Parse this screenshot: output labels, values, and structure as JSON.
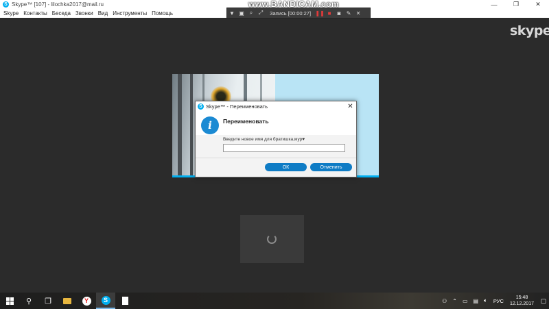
{
  "window": {
    "title": "Skype™ [107] - lilochka2017@mail.ru",
    "minimize_glyph": "—",
    "maximize_glyph": "❐",
    "close_glyph": "✕"
  },
  "menu": {
    "items": [
      {
        "label": "Skype"
      },
      {
        "label": "Контакты"
      },
      {
        "label": "Беседа"
      },
      {
        "label": "Звонки"
      },
      {
        "label": "Вид"
      },
      {
        "label": "Инструменты"
      },
      {
        "label": "Помощь"
      }
    ]
  },
  "bandicam": {
    "brand": "www.BANDICAM.com",
    "record_label": "Запись [00:00:27]"
  },
  "skype_logo": "skype",
  "dialog": {
    "title": "Skype™ - Переименовать",
    "heading": "Переименовать",
    "prompt": "Введите новое имя для братишка,мур♥",
    "input_value": "",
    "ok_label": "ОК",
    "cancel_label": "Отменить",
    "accent_color": "#0f7cc5"
  },
  "taskbar": {
    "language": "РУС",
    "time": "15:48",
    "date": "12.12.2017"
  },
  "icons": {
    "start": "windows-icon",
    "search": "search-icon",
    "task_view": "task-view-icon",
    "explorer": "folder-icon",
    "yandex": "yandex-browser-icon",
    "skype": "skype-icon",
    "document": "document-icon",
    "info": "info-icon"
  }
}
